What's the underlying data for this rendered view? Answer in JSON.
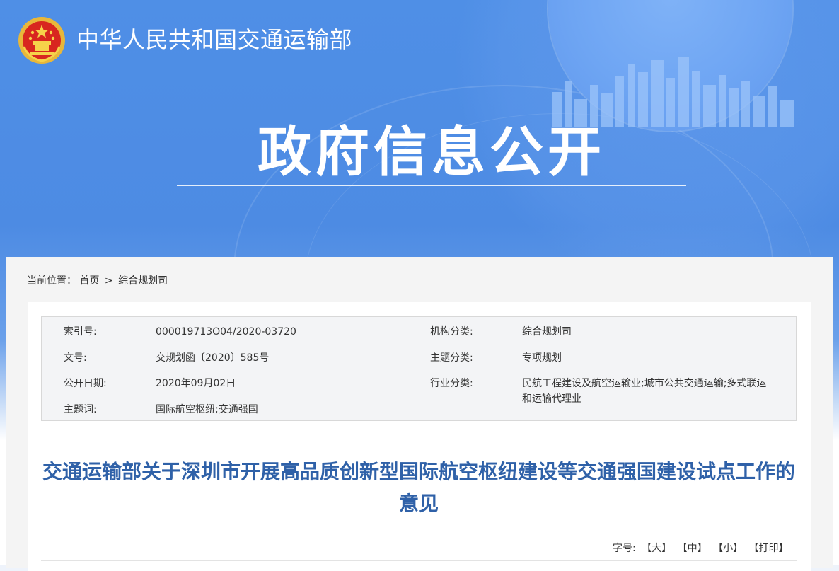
{
  "header": {
    "site_title": "中华人民共和国交通运输部",
    "section_title": "政府信息公开",
    "emblem_icon": "national-emblem-icon"
  },
  "breadcrumb": {
    "prefix": "当前位置：",
    "items": [
      "首页",
      "综合规划司"
    ],
    "separator": ">"
  },
  "meta": {
    "index_label": "索引号:",
    "index_value": "000019713O04/2020-03720",
    "org_label": "机构分类:",
    "org_value": "综合规划司",
    "doc_no_label": "文号:",
    "doc_no_value": "交规划函〔2020〕585号",
    "topic_label": "主题分类:",
    "topic_value": "专项规划",
    "date_label": "公开日期:",
    "date_value": "2020年09月02日",
    "industry_label": "行业分类:",
    "industry_value": "民航工程建设及航空运输业;城市公共交通运输;多式联运和运输代理业",
    "keyword_label": "主题词:",
    "keyword_value": "国际航空枢纽;交通强国"
  },
  "document": {
    "title": "交通运输部关于深圳市开展高品质创新型国际航空枢纽建设等交通强国建设试点工作的意见"
  },
  "font_tools": {
    "label": "字号:",
    "large": "【大】",
    "medium": "【中】",
    "small": "【小】",
    "print": "【打印】"
  },
  "colors": {
    "banner_blue": "#4f8fe6",
    "title_blue": "#2f61a8"
  }
}
